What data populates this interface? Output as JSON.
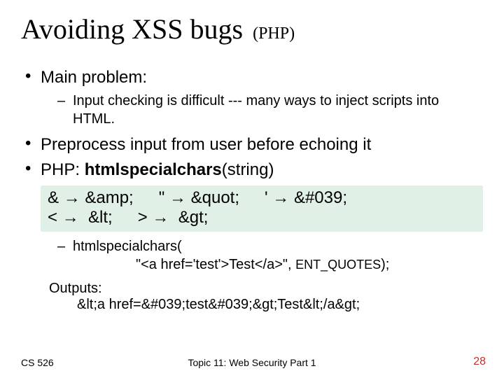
{
  "title": "Avoiding XSS bugs",
  "title_sub": "(PHP)",
  "bullets": {
    "main_problem": "Main problem:",
    "main_problem_sub": "Input checking is difficult  ---  many ways to inject scripts into HTML.",
    "preprocess": "Preprocess input from user before echoing it",
    "php_prefix": "PHP:  ",
    "php_fn": "htmlspecialchars",
    "php_suffix": "(string)"
  },
  "chart_data": {
    "type": "table",
    "title": "htmlspecialchars mapping",
    "rows": [
      {
        "from": "&",
        "to": "&amp;"
      },
      {
        "from": "\"",
        "to": "&quot;"
      },
      {
        "from": "'",
        "to": "&#039;"
      },
      {
        "from": "<",
        "to": "&lt;"
      },
      {
        "from": ">",
        "to": "&gt;"
      }
    ],
    "arrow": "→"
  },
  "example": {
    "fn": "htmlspecialchars",
    "open": "(",
    "arg_string": "\"<a href='test'>Test</a>\", ",
    "arg_flag": "ENT_QUOTES",
    "close": ");",
    "outputs_label": "Outputs:",
    "outputs_value": "&lt;a href=&#039;test&#039;&gt;Test&lt;/a&gt;"
  },
  "footer": {
    "left": "CS 526",
    "center": "Topic 11: Web Security Part 1",
    "right": "28"
  }
}
